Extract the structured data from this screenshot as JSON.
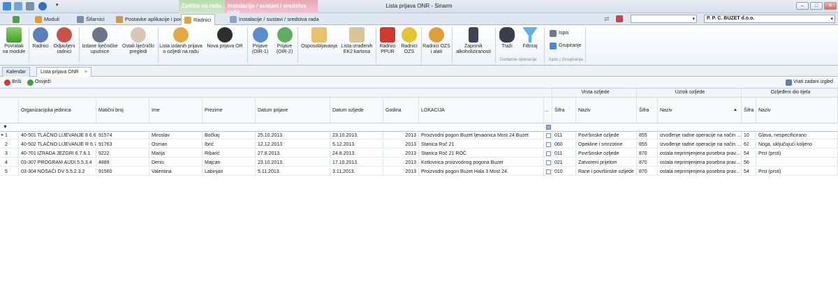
{
  "window": {
    "title": "Lista prijava ONR - Sinarm"
  },
  "context_tabs": {
    "zastita": "Zaštita na radu",
    "instalacije": "Instalacije / sustavi / sredstva rada"
  },
  "tabs": [
    {
      "label": "Moduli"
    },
    {
      "label": "Šifarnici"
    },
    {
      "label": "Postavke aplikacije i pomoć"
    },
    {
      "label": "Radnici"
    },
    {
      "label": "Instalacije / sustavi / sredstva rada"
    }
  ],
  "company": "P. P. C. BUZET d.o.o.",
  "ribbon": {
    "povratak": "Povratak na module",
    "radnici": "Radnici",
    "odjavljeni": "Odjavljeni radnici",
    "izdane": "Izdane liječničke uputnice",
    "ostali": "Ostali liječnički pregledi",
    "lista_izdanih": "Lista izdanih prijava o ozljedi na radu",
    "nova_prijava": "Nova prijava OR",
    "prijave1": "Prijave (OIR-1)",
    "prijave2": "Prijave (OIR-2)",
    "osposobljavanja": "Osposobljavanja",
    "lista_ek2": "Lista izrađenih EK2 kartona",
    "radnici_ppur": "Radnici PPUR",
    "radnici_ozs": "Radnici OZS",
    "radnici_ozs_alati": "Radnici OZS i alati",
    "zapisnik": "Zapisnik alkoholiziranosti",
    "trazi": "Traži",
    "filtriraj": "Filtriraj",
    "dodatne": "Dodatne operacije",
    "ispis": "Ispis",
    "grupiranje": "Grupiranje",
    "ispis_grupiranje": "Ispis | Grupiranje"
  },
  "doc_tabs": [
    {
      "label": "Kalendar"
    },
    {
      "label": "Lista prijava ONR"
    }
  ],
  "toolbar": {
    "brisi": "Briši",
    "osvjezi": "Osvježi",
    "vrati": "Vrati zadani izgled"
  },
  "grid": {
    "groups": {
      "vrsta": "Vrsta ozljede",
      "uzrok": "Uzrok ozljede",
      "ozljedeni": "Ozljeđeni dio tijela"
    },
    "columns": {
      "org": "Organizacijska jedinica",
      "mb": "Matični broj",
      "ime": "Ime",
      "prezime": "Prezime",
      "datum_prijave": "Datum prijave",
      "datum_ozljede": "Datum ozljede",
      "godina": "Godina",
      "lokacija": "LOKACIJA",
      "dots": "...",
      "sifra": "Šifra",
      "naziv": "Naziv"
    },
    "rows": [
      {
        "n": "1",
        "org": "40-501 TLAČNO LIJEVANJE 8 6.6....",
        "mb": "91574",
        "ime": "Miroslav",
        "prezime": "Bočkaj",
        "dp": "25.10.2013.",
        "doz": "23.10.2013.",
        "god": "2013",
        "lok": "Proizvodni pogon Buzet ljevaonica Most 24 Buzet",
        "vs": "011",
        "vn": "Površinske ozljede",
        "us": "855",
        "un": "izvođenje radne operacije na način ...",
        "os": "10",
        "on": "Glava, nespecificirano"
      },
      {
        "n": "2",
        "org": "40-502 TLAČNO LIJEVANJE R 6.7.4",
        "mb": "91763",
        "ime": "Osman",
        "prezime": "Ibrić",
        "dp": "12.12.2013.",
        "doz": "5.12.2013.",
        "god": "2013",
        "lok": "Stanica Roč 21",
        "vs": "060",
        "vn": "Opekline i smrzotine",
        "us": "855",
        "un": "izvođenje radne operacije na način ...",
        "os": "62",
        "on": "Noga, uključujući koljeno"
      },
      {
        "n": "3",
        "org": "40-701 IZRADA JEZGRI 6.7.6.1",
        "mb": "9222",
        "ime": "Marija",
        "prezime": "Ribarić",
        "dp": "27.8.2013.",
        "doz": "24.8.2013.",
        "god": "2013",
        "lok": "Stanica Roč 21 ROČ",
        "vs": "011",
        "vn": "Površinske ozljede",
        "us": "870",
        "un": "ostala neprimjenjena posebna prav...",
        "os": "54",
        "on": "Prst (prsti)"
      },
      {
        "n": "4",
        "org": "03-307 PROGRAM AUDI 5.5.3.4",
        "mb": "4889",
        "ime": "Denis",
        "prezime": "Majcan",
        "dp": "23.10.2013.",
        "doz": "17.10.2013.",
        "god": "2013",
        "lok": "Kotlovnica proizvodnog pogona Buzet",
        "vs": "021",
        "vn": "Zatvoreni prijelom",
        "us": "870",
        "un": "ostala neprimjenjena posebna prav...",
        "os": "56",
        "on": ""
      },
      {
        "n": "5",
        "org": "03-304 NOSAČI DV 5.5.2.3.2",
        "mb": "91560",
        "ime": "Valentina",
        "prezime": "Labinjan",
        "dp": "5.11.2013.",
        "doz": "3.11.2013.",
        "god": "2013",
        "lok": "Proizvodni pogon Buzet Hala 3 Most 24.",
        "vs": "010",
        "vn": "Rane i površinske ozljede",
        "us": "870",
        "un": "ostala neprimjenjena posebna prav...",
        "os": "54",
        "on": "Prst (prsti)"
      }
    ]
  }
}
